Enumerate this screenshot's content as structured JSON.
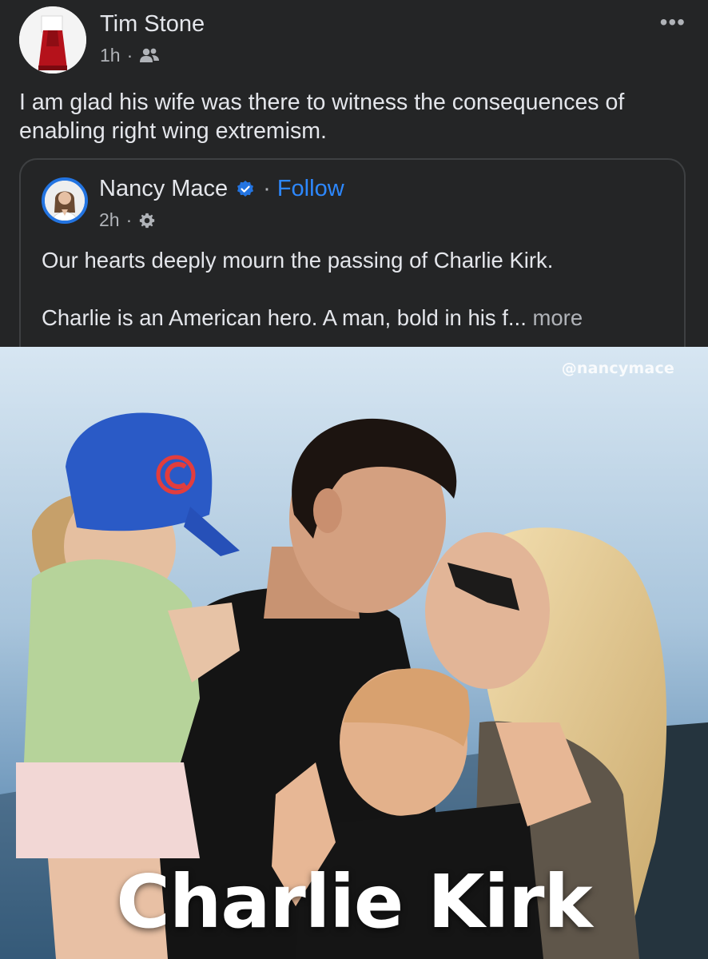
{
  "post": {
    "author": "Tim Stone",
    "time": "1h",
    "separator": "·",
    "audience_icon": "friends-icon",
    "text": "I am glad his wife was there to witness the consequences of enabling right wing extremism.",
    "more_options_label": "•••"
  },
  "shared": {
    "author": "Nancy Mace",
    "verified_icon": "verified-badge-icon",
    "separator": "·",
    "follow_label": "Follow",
    "time": "2h",
    "audience_icon": "gear-icon",
    "text_line1": "Our hearts deeply mourn the passing of Charlie Kirk.",
    "text_line2": "Charlie is an American hero. A man, bold in his f... ",
    "see_more_label": "more"
  },
  "photo": {
    "watermark": "@nancymace",
    "caption": "Charlie Kirk",
    "cap_letter": "C"
  },
  "colors": {
    "background": "#242526",
    "text_primary": "#e4e6eb",
    "text_secondary": "#b0b3b8",
    "link_blue": "#2d88ff",
    "verified_blue": "#2374e1"
  }
}
